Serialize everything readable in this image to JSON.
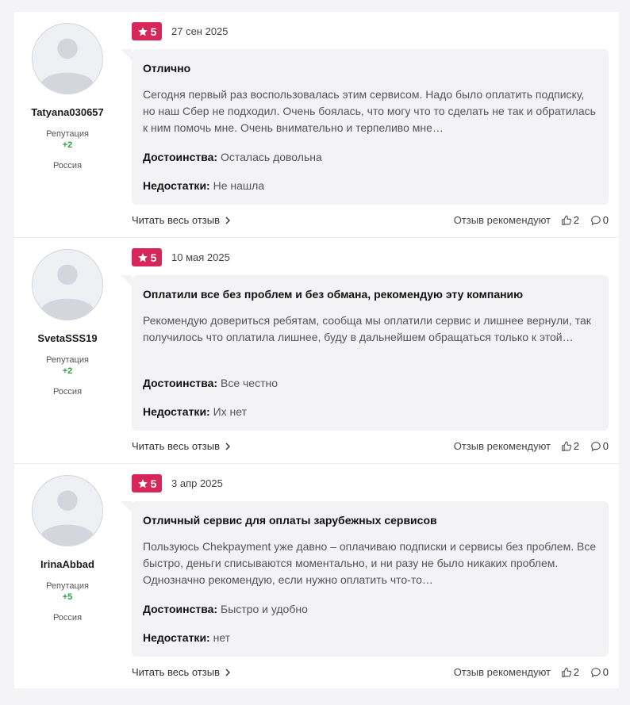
{
  "reviews": [
    {
      "author": "Tatyana030657",
      "reputation_label": "Репутация",
      "reputation": "+2",
      "country": "Россия",
      "rating": "5",
      "date": "27 сен 2025",
      "title": "Отлично",
      "text": "Сегодня первый раз воспользовалась этим сервисом. Надо было оплатить подписку, но наш Сбер не подходил. Очень боялась, что могу что то сделать не так и обратилась к ним помочь мне. Очень внимательно и терпеливо мне…",
      "pros_label": "Достоинства:",
      "pros": "Осталась довольна",
      "cons_label": "Недостатки:",
      "cons": "Не нашла",
      "read_more": "Читать весь отзыв",
      "recommend": "Отзыв рекомендуют",
      "likes": "2",
      "comments": "0"
    },
    {
      "author": "SvetaSSS19",
      "reputation_label": "Репутация",
      "reputation": "+2",
      "country": "Россия",
      "rating": "5",
      "date": "10 мая 2025",
      "title": "Оплатили все без проблем и без обмана, рекомендую эту компанию",
      "text": "Рекомендую довериться ребятам, сообща мы оплатили сервис и лишнее вернули, так получилось что оплатила лишнее, буду в дальнейшем обращаться только к этой…",
      "pros_label": "Достоинства:",
      "pros": "Все честно",
      "cons_label": "Недостатки:",
      "cons": "Их нет",
      "read_more": "Читать весь отзыв",
      "recommend": "Отзыв рекомендуют",
      "likes": "2",
      "comments": "0"
    },
    {
      "author": "IrinaAbbad",
      "reputation_label": "Репутация",
      "reputation": "+5",
      "country": "Россия",
      "rating": "5",
      "date": "3 апр 2025",
      "title": "Отличный сервис для оплаты зарубежных сервисов",
      "text": "Пользуюсь Chekpayment уже давно – оплачиваю подписки и сервисы без проблем. Все быстро, деньги списываются моментально, и ни разу не было никаких проблем. Однозначно рекомендую, если нужно оплатить что-то…",
      "pros_label": "Достоинства:",
      "pros": "Быстро и удобно",
      "cons_label": "Недостатки:",
      "cons": "нет",
      "read_more": "Читать весь отзыв",
      "recommend": "Отзыв рекомендуют",
      "likes": "2",
      "comments": "0"
    }
  ],
  "colors": {
    "rating_badge": "#d7265a",
    "reputation_positive": "#2f9e44",
    "bubble_background": "#f3f3f5"
  },
  "icons": {
    "rating": "star-icon",
    "avatar": "user-placeholder-icon",
    "read_more": "chevron-right-icon",
    "likes": "thumbs-up-icon",
    "comments": "comment-icon"
  }
}
